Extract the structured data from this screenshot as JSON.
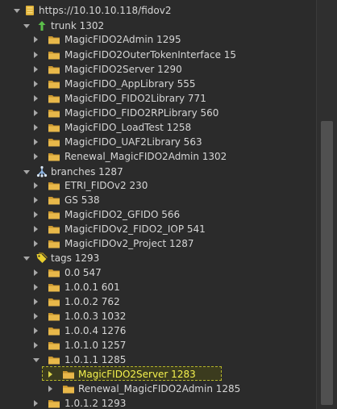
{
  "tree": {
    "rows": [
      {
        "label": "https://10.10.10.118/fidov2",
        "icon": "repository-icon",
        "depth": 0,
        "state": "expanded"
      },
      {
        "label": "trunk 1302",
        "icon": "trunk-icon",
        "depth": 1,
        "state": "expanded"
      },
      {
        "label": "MagicFIDO2Admin 1295",
        "icon": "folder-icon",
        "depth": 2,
        "state": "collapsed"
      },
      {
        "label": "MagicFIDO2OuterTokenInterface 15",
        "icon": "folder-icon",
        "depth": 2,
        "state": "collapsed"
      },
      {
        "label": "MagicFIDO2Server 1290",
        "icon": "folder-icon",
        "depth": 2,
        "state": "collapsed"
      },
      {
        "label": "MagicFIDO_AppLibrary 555",
        "icon": "folder-icon",
        "depth": 2,
        "state": "collapsed"
      },
      {
        "label": "MagicFIDO_FIDO2Library 771",
        "icon": "folder-icon",
        "depth": 2,
        "state": "collapsed"
      },
      {
        "label": "MagicFIDO_FIDO2RPLibrary 560",
        "icon": "folder-icon",
        "depth": 2,
        "state": "collapsed"
      },
      {
        "label": "MagicFIDO_LoadTest 1258",
        "icon": "folder-icon",
        "depth": 2,
        "state": "collapsed"
      },
      {
        "label": "MagicFIDO_UAF2Library 563",
        "icon": "folder-icon",
        "depth": 2,
        "state": "collapsed"
      },
      {
        "label": "Renewal_MagicFIDO2Admin 1302",
        "icon": "folder-icon",
        "depth": 2,
        "state": "collapsed"
      },
      {
        "label": "branches 1287",
        "icon": "branches-icon",
        "depth": 1,
        "state": "expanded"
      },
      {
        "label": "ETRI_FIDOv2 230",
        "icon": "folder-icon",
        "depth": 2,
        "state": "collapsed"
      },
      {
        "label": "GS 538",
        "icon": "folder-icon",
        "depth": 2,
        "state": "collapsed"
      },
      {
        "label": "MagicFIDO2_GFIDO 566",
        "icon": "folder-icon",
        "depth": 2,
        "state": "collapsed"
      },
      {
        "label": "MagicFIDOv2_FIDO2_IOP 541",
        "icon": "folder-icon",
        "depth": 2,
        "state": "collapsed"
      },
      {
        "label": "MagicFIDOv2_Project 1287",
        "icon": "folder-icon",
        "depth": 2,
        "state": "collapsed"
      },
      {
        "label": "tags 1293",
        "icon": "tags-icon",
        "depth": 1,
        "state": "expanded"
      },
      {
        "label": "0.0 547",
        "icon": "folder-icon",
        "depth": 2,
        "state": "collapsed"
      },
      {
        "label": "1.0.0.1 601",
        "icon": "folder-icon",
        "depth": 2,
        "state": "collapsed"
      },
      {
        "label": "1.0.0.2 762",
        "icon": "folder-icon",
        "depth": 2,
        "state": "collapsed"
      },
      {
        "label": "1.0.0.3 1032",
        "icon": "folder-icon",
        "depth": 2,
        "state": "collapsed"
      },
      {
        "label": "1.0.0.4 1276",
        "icon": "folder-icon",
        "depth": 2,
        "state": "collapsed"
      },
      {
        "label": "1.0.1.0 1257",
        "icon": "folder-icon",
        "depth": 2,
        "state": "collapsed"
      },
      {
        "label": "1.0.1.1 1285",
        "icon": "folder-icon",
        "depth": 2,
        "state": "expanded"
      },
      {
        "label": "MagicFIDO2Server 1283",
        "icon": "folder-icon",
        "depth": 3,
        "state": "collapsed",
        "selected": true
      },
      {
        "label": "Renewal_MagicFIDO2Admin 1285",
        "icon": "folder-icon",
        "depth": 3,
        "state": "collapsed"
      },
      {
        "label": "1.0.1.2 1293",
        "icon": "folder-icon",
        "depth": 2,
        "state": "collapsed"
      }
    ]
  },
  "colors": {
    "background": "#2b2b2b",
    "text": "#d6d6d6",
    "selection_text": "#f5f24e",
    "folder": "#e8b84a"
  }
}
